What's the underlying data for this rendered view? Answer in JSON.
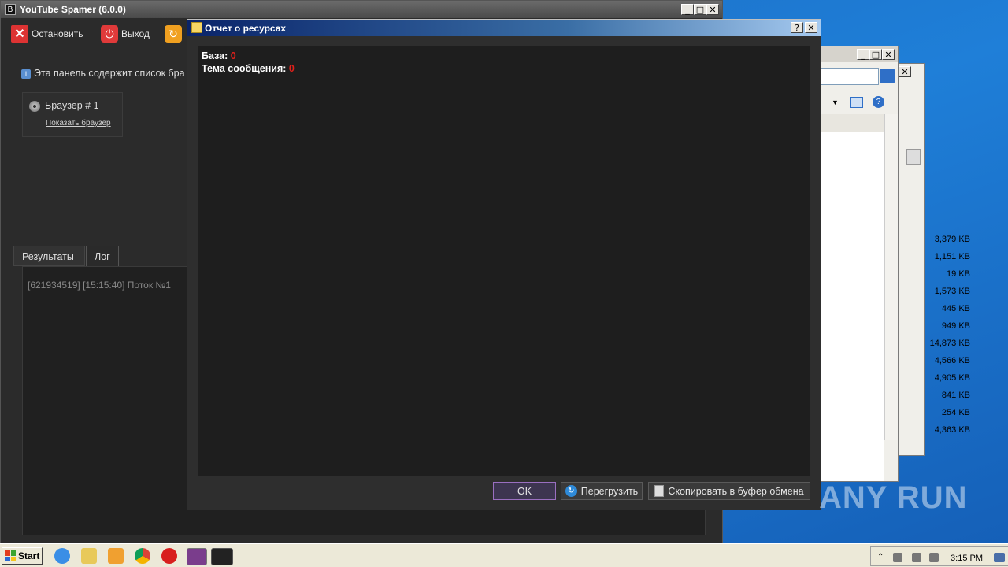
{
  "main_window": {
    "title": "YouTube Spamer (6.0.0)",
    "toolbar": {
      "stop_label": "Остановить",
      "exit_label": "Выход"
    },
    "info_text": "Эта панель содержит список бра",
    "browser_card": {
      "name": "Браузер # 1",
      "link": "Показать браузер"
    },
    "tabs": [
      {
        "label": "Результаты"
      },
      {
        "label": "Лог"
      }
    ],
    "log_line": "[621934519] [15:15:40] Поток №1"
  },
  "dialog": {
    "title": "Отчет о ресурсах",
    "rows": [
      {
        "label": "База",
        "value": "0"
      },
      {
        "label": "Тема сообщения",
        "value": "0"
      }
    ],
    "buttons": {
      "ok": "OK",
      "reload": "Перегрузить",
      "copy": "Скопировать в буфер обмена"
    }
  },
  "bg_window": {
    "sizes": [
      "3,379 KB",
      "1,151 KB",
      "19 KB",
      "1,573 KB",
      "445 KB",
      "949 KB",
      "14,873 KB",
      "4,566 KB",
      "4,905 KB",
      "841 KB",
      "254 KB",
      "4,363 KB"
    ]
  },
  "taskbar": {
    "start_label": "Start",
    "clock": "3:15 PM"
  },
  "watermark": "ANY RUN"
}
